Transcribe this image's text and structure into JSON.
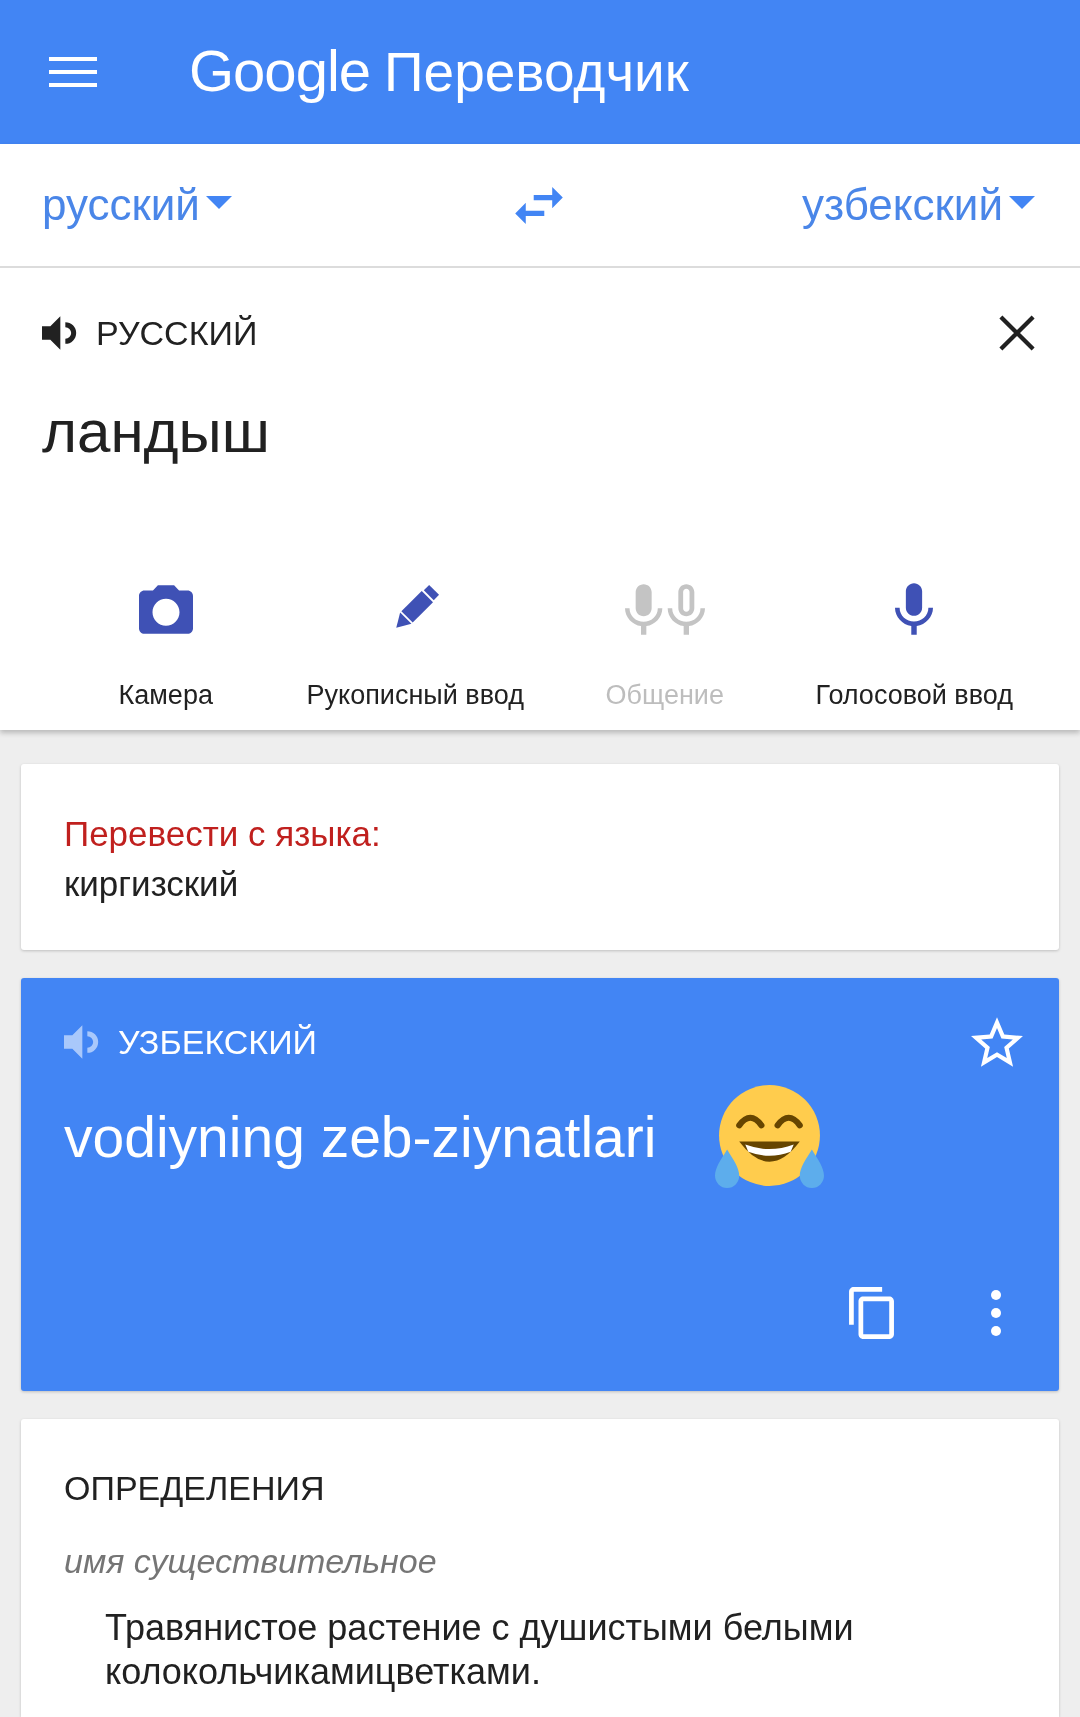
{
  "app_bar": {
    "brand": "Google",
    "title": "Переводчик"
  },
  "language_bar": {
    "source": "русский",
    "target": "узбекский"
  },
  "input": {
    "language": "РУССКИЙ",
    "audio_enabled": true,
    "text": "ландыш",
    "tools": [
      {
        "kind": "camera",
        "label": "Камера",
        "disabled": false
      },
      {
        "kind": "handwriting",
        "label": "Рукописный ввод",
        "disabled": false
      },
      {
        "kind": "conversation",
        "label": "Общение",
        "disabled": true
      },
      {
        "kind": "voice",
        "label": "Голосовой ввод",
        "disabled": false
      }
    ]
  },
  "detected_language": {
    "prompt": "Перевести с языка:",
    "language": "киргизский"
  },
  "translation": {
    "language": "УЗБЕКСКИЙ",
    "audio_enabled": false,
    "text": "vodiyning zeb-ziynatlari",
    "starred": false
  },
  "definitions": {
    "title": "ОПРЕДЕЛЕНИЯ",
    "entries": [
      {
        "part_of_speech": "имя существительное",
        "senses": [
          "Травянистое растение с душистыми белыми колокольчикамицветками."
        ]
      }
    ]
  }
}
